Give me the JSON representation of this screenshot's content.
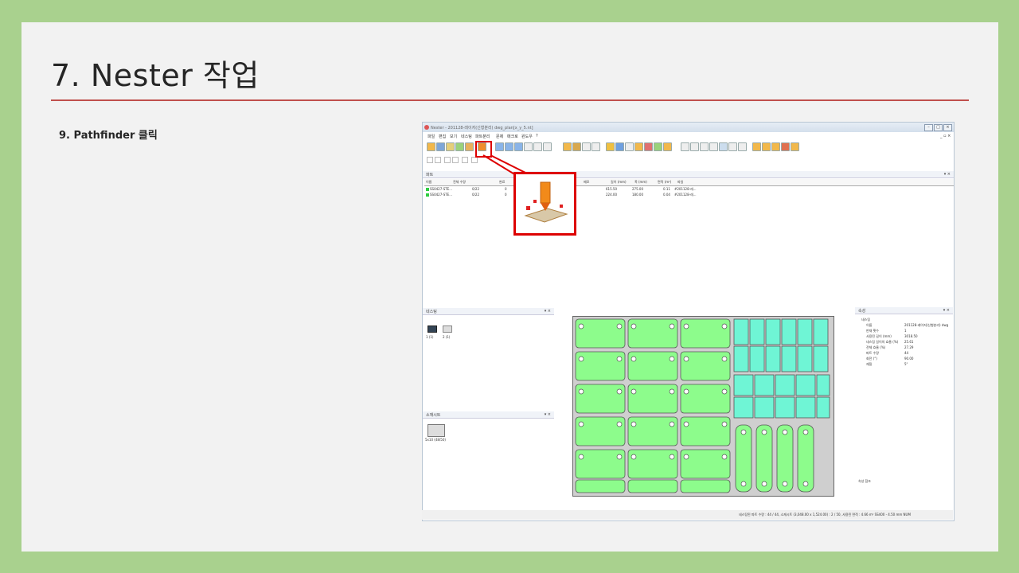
{
  "slide": {
    "title": "7. Nester 작업",
    "step": "9.  Pathfinder 클릭"
  },
  "app": {
    "window_title": "Nester - 201128-레이저(신형분리) dwg_plan[x_y_5.nt]",
    "menu": [
      "파일",
      "편집",
      "보기",
      "네스팅",
      "파트분리",
      "문제",
      "매크로",
      "윈도우",
      "?"
    ],
    "parts_panel_title": "파트",
    "parts_columns": [
      "이름",
      "전체 수량",
      "완료",
      "남음",
      "메모",
      "길이 (mm)",
      "폭 (mm)",
      "면적 (m²)",
      "파일"
    ],
    "parts_rows": [
      {
        "name": "SS0427-STE...",
        "qty": "0/22",
        "done": "0",
        "remain": "",
        "length": "615.50",
        "width": "275.00",
        "area": "0.11",
        "file": "#201128-레..."
      },
      {
        "name": "SS0427-STE...",
        "qty": "0/22",
        "done": "0",
        "remain": "",
        "length": "224.00",
        "width": "180.00",
        "area": "0.04",
        "file": "#201128-레..."
      }
    ],
    "nesting_panel_title": "네스팅",
    "nest_items": [
      "1 (1)",
      "2 (1)"
    ],
    "sheet_panel_title": "소재시트",
    "sheet_item": "5x10 (48/50)",
    "property_panel_title": "속성",
    "properties": [
      {
        "k": "네스팅",
        "v": ""
      },
      {
        "k": "이름",
        "v": "201128-레이저(신형분리) dwg"
      },
      {
        "k": "판재 횟수",
        "v": "1"
      },
      {
        "k": "사용된 길이 (mm)",
        "v": "3018.50"
      },
      {
        "k": "네스팅 길이의 효율 (%)",
        "v": "25.61"
      },
      {
        "k": "전체 효율 (%)",
        "v": "27.29"
      },
      {
        "k": "파트 수량",
        "v": "44"
      },
      {
        "k": "회전 (°)",
        "v": "90.00"
      },
      {
        "k": "재질",
        "v": "5\""
      }
    ],
    "status_text": "네스팅된 파트 수량 : 44 / 44, 소재시트 (3,048.00 x 1,524.00) : 2 / 50, 사용된 면적 : 4.66 m²   SS400 - 4.50 mm      NUM",
    "bottom_tabs": "속성   참조"
  },
  "colors": {
    "background": "#a9d18e",
    "slide": "#f2f2f2",
    "accent_rule": "#c0504d",
    "highlight": "#dd0000",
    "part_green": "#8dfc8c",
    "part_cyan": "#6ff5d5"
  }
}
